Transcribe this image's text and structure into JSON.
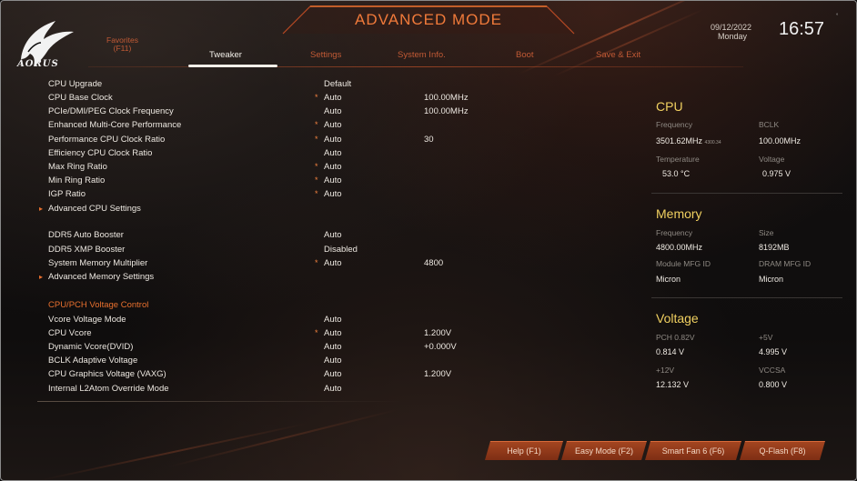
{
  "header": {
    "mode_title": "ADVANCED MODE",
    "brand": "AORUS",
    "date": "09/12/2022",
    "day": "Monday",
    "time": "16:57"
  },
  "tabs": [
    {
      "label": "Favorites",
      "sub": "(F11)",
      "active": false
    },
    {
      "label": "Tweaker",
      "active": true
    },
    {
      "label": "Settings",
      "active": false
    },
    {
      "label": "System Info.",
      "active": false
    },
    {
      "label": "Boot",
      "active": false
    },
    {
      "label": "Save & Exit",
      "active": false
    }
  ],
  "settings": [
    {
      "name": "CPU Upgrade",
      "value": "Default",
      "star": false,
      "extra": ""
    },
    {
      "name": "CPU Base Clock",
      "value": "Auto",
      "star": true,
      "extra": "100.00MHz"
    },
    {
      "name": "PCIe/DMI/PEG Clock Frequency",
      "value": "Auto",
      "star": false,
      "extra": "100.00MHz"
    },
    {
      "name": "Enhanced Multi-Core Performance",
      "value": "Auto",
      "star": true,
      "extra": ""
    },
    {
      "name": "Performance CPU Clock Ratio",
      "value": "Auto",
      "star": true,
      "extra": "30"
    },
    {
      "name": "Efficiency CPU Clock Ratio",
      "value": "Auto",
      "star": false,
      "extra": ""
    },
    {
      "name": "Max Ring Ratio",
      "value": "Auto",
      "star": true,
      "extra": ""
    },
    {
      "name": "Min Ring Ratio",
      "value": "Auto",
      "star": true,
      "extra": ""
    },
    {
      "name": "IGP Ratio",
      "value": "Auto",
      "star": true,
      "extra": ""
    },
    {
      "name": "Advanced CPU Settings",
      "submenu": true
    },
    {
      "name": "DDR5 Auto Booster",
      "value": "Auto",
      "star": false,
      "extra": ""
    },
    {
      "name": "DDR5 XMP Booster",
      "value": "Disabled",
      "star": false,
      "extra": ""
    },
    {
      "name": "System Memory Multiplier",
      "value": "Auto",
      "star": true,
      "extra": "4800"
    },
    {
      "name": "Advanced Memory Settings",
      "submenu": true
    },
    {
      "name": "CPU/PCH Voltage Control",
      "section": true
    },
    {
      "name": "Vcore Voltage Mode",
      "value": "Auto",
      "star": false,
      "extra": ""
    },
    {
      "name": "CPU Vcore",
      "value": "Auto",
      "star": true,
      "extra": "1.200V"
    },
    {
      "name": "Dynamic Vcore(DVID)",
      "value": "Auto",
      "star": false,
      "extra": "+0.000V"
    },
    {
      "name": "BCLK Adaptive Voltage",
      "value": "Auto",
      "star": false,
      "extra": ""
    },
    {
      "name": "CPU Graphics Voltage (VAXG)",
      "value": "Auto",
      "star": false,
      "extra": "1.200V"
    },
    {
      "name": "Internal L2Atom Override Mode",
      "value": "Auto",
      "star": false,
      "extra": ""
    }
  ],
  "cpu": {
    "title": "CPU",
    "frequency_label": "Frequency",
    "bclk_label": "BCLK",
    "frequency_value": "3501.62MHz",
    "frequency_small": "4300.34",
    "bclk_value": "100.00MHz",
    "temperature_label": "Temperature",
    "voltage_label": "Voltage",
    "temperature_value": "53.0 °C",
    "voltage_value": "0.975 V"
  },
  "memory": {
    "title": "Memory",
    "frequency_label": "Frequency",
    "size_label": "Size",
    "frequency_value": "4800.00MHz",
    "size_value": "8192MB",
    "module_label": "Module MFG ID",
    "dram_label": "DRAM MFG ID",
    "module_value": "Micron",
    "dram_value": "Micron"
  },
  "voltage": {
    "title": "Voltage",
    "pch_label": "PCH 0.82V",
    "p5v_label": "+5V",
    "pch_value": "0.814 V",
    "p5v_value": "4.995 V",
    "p12v_label": "+12V",
    "vccsa_label": "VCCSA",
    "p12v_value": "12.132 V",
    "vccsa_value": "0.800 V"
  },
  "footer": {
    "help": "Help (F1)",
    "easy_mode": "Easy Mode (F2)",
    "smart_fan": "Smart Fan 6 (F6)",
    "qflash": "Q-Flash (F8)"
  },
  "colors": {
    "accent": "#e8702e",
    "title": "#f07a3a",
    "panel_heading": "#f0d060"
  }
}
